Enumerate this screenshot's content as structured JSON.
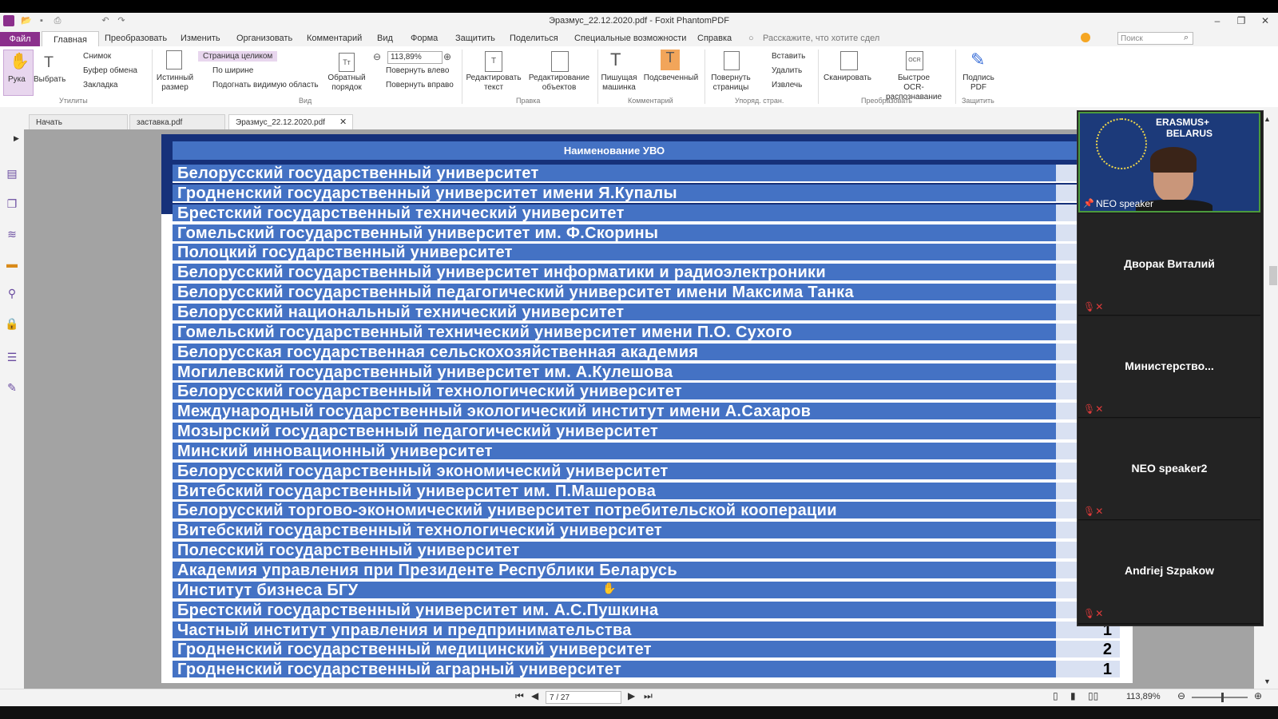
{
  "app": {
    "title": "Эразмус_22.12.2020.pdf - Foxit PhantomPDF"
  },
  "menu": {
    "file": "Файл",
    "items": [
      "Главная",
      "Преобразовать",
      "Изменить",
      "Организовать",
      "Комментарий",
      "Вид",
      "Форма",
      "Защитить",
      "Поделиться",
      "Специальные возможности",
      "Справка"
    ],
    "tell_me": "Расскажите, что хотите сдел",
    "search_placeholder": "Поиск"
  },
  "ribbon": {
    "hand": "Рука",
    "select": "Выбрать",
    "snapshot": "Снимок",
    "clipboard": "Буфер обмена",
    "bookmark": "Закладка",
    "utilities_group": "Утилиты",
    "actual_size_1": "Истинный",
    "actual_size_2": "размер",
    "fit_page": "Страница целиком",
    "fit_width": "По ширине",
    "fit_visible": "Подогнать видимую область",
    "reverse_1": "Обратный",
    "reverse_2": "порядок",
    "zoom_value": "113,89%",
    "rotate_left": "Повернуть влево",
    "rotate_right": "Повернуть вправо",
    "view_group": "Вид",
    "edit_text_1": "Редактировать",
    "edit_text_2": "текст",
    "edit_obj_1": "Редактирование",
    "edit_obj_2": "объектов",
    "edit_group": "Правка",
    "typewriter_1": "Пишущая",
    "typewriter_2": "машинка",
    "highlight": "Подсвеченный",
    "comment_group": "Комментарий",
    "rotate_pages_1": "Повернуть",
    "rotate_pages_2": "страницы",
    "insert": "Вставить",
    "delete": "Удалить",
    "extract": "Извлечь",
    "pages_group": "Упоряд. стран.",
    "scan": "Сканировать",
    "ocr_1": "Быстрое",
    "ocr_2": "OCR-распознавание",
    "convert_group": "Преобразовать",
    "sign_1": "Подпись",
    "sign_2": "PDF",
    "protect_group": "Защитить"
  },
  "tabs": [
    "Начать",
    "заставка.pdf",
    "Эразмус_22.12.2020.pdf"
  ],
  "table": {
    "header": "Наименование УВО",
    "rows": [
      "Белорусский государственный университет",
      "Гродненский государственный университет имени Я.Купалы",
      "Брестский государственный технический университет",
      "Гомельский государственный университет им. Ф.Скорины",
      "Полоцкий государственный университет",
      "Белорусский государственный университет информатики и радиоэлектроники",
      "Белорусский государственный педагогический университет имени Максима Танка",
      "Белорусский национальный технический университет",
      "Гомельский государственный технический университет имени П.О. Сухого",
      "Белорусская государственная сельскохозяйственная академия",
      "Могилевский государственный университет им. А.Кулешова",
      "Белорусский государственный технологический университет",
      "Международный государственный экологический институт имени А.Сахаров",
      "Мозырский государственный педагогический университет",
      "Минский инновационный университет",
      "Белорусский государственный экономический университет",
      "Витебский государственный университет им. П.Машерова",
      "Белорусский торгово-экономический университет потребительской кооперации",
      "Витебский государственный технологический университет",
      "Полесский государственный университет",
      "Академия управления при Президенте Республики Беларусь",
      "Институт бизнеса БГУ",
      "Брестский государственный университет им. А.С.Пушкина",
      "Частный институт управления и предпринимательства",
      "Гродненский государственный медицинский университет",
      "Гродненский государственный аграрный университет"
    ],
    "counts": [
      "",
      "",
      "",
      "",
      "",
      "",
      "",
      "",
      "",
      "",
      "",
      "",
      "",
      "",
      "",
      "",
      "",
      "",
      "",
      "",
      "",
      "",
      "",
      "1",
      "2",
      "1"
    ]
  },
  "status": {
    "page_indicator": "7 / 27",
    "zoom": "113,89%"
  },
  "video": {
    "banner_1": "ERASMUS+",
    "banner_2": "BELARUS",
    "speaker_label": "NEO speaker",
    "participants": [
      "Дворак Виталий",
      "Министерство...",
      "NEO speaker2",
      "Andriej Szpakow"
    ]
  },
  "colors": {
    "row_blue": "#4472c4",
    "header_dark": "#16317a",
    "accent": "#8b2f8c"
  }
}
